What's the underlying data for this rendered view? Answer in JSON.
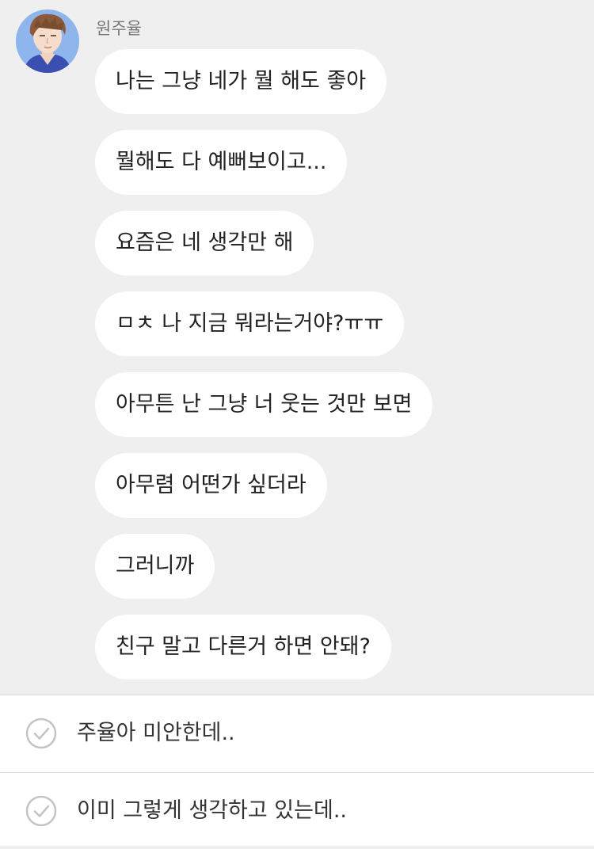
{
  "chat": {
    "sender_name": "원주율",
    "avatar_icon": "young-man-portrait-icon",
    "messages": [
      "나는 그냥 네가 뭘 해도 좋아",
      "뭘해도 다 예뻐보이고...",
      "요즘은 네 생각만 해",
      "ㅁㅊ 나 지금  뭐라는거야?ㅠㅠ",
      "아무튼 난 그냥 너 웃는 것만 보면",
      "아무렴 어떤가 싶더라",
      "그러니까",
      "친구 말고 다른거 하면 안돼?"
    ]
  },
  "choices": [
    {
      "label": "주율아 미안한데..",
      "icon": "check-circle-icon"
    },
    {
      "label": "이미 그렇게 생각하고 있는데..",
      "icon": "check-circle-icon"
    }
  ],
  "colors": {
    "chat_background": "#efefef",
    "bubble": "#ffffff",
    "choice_panel": "#ffffff",
    "check_icon": "#c4c4c4"
  }
}
